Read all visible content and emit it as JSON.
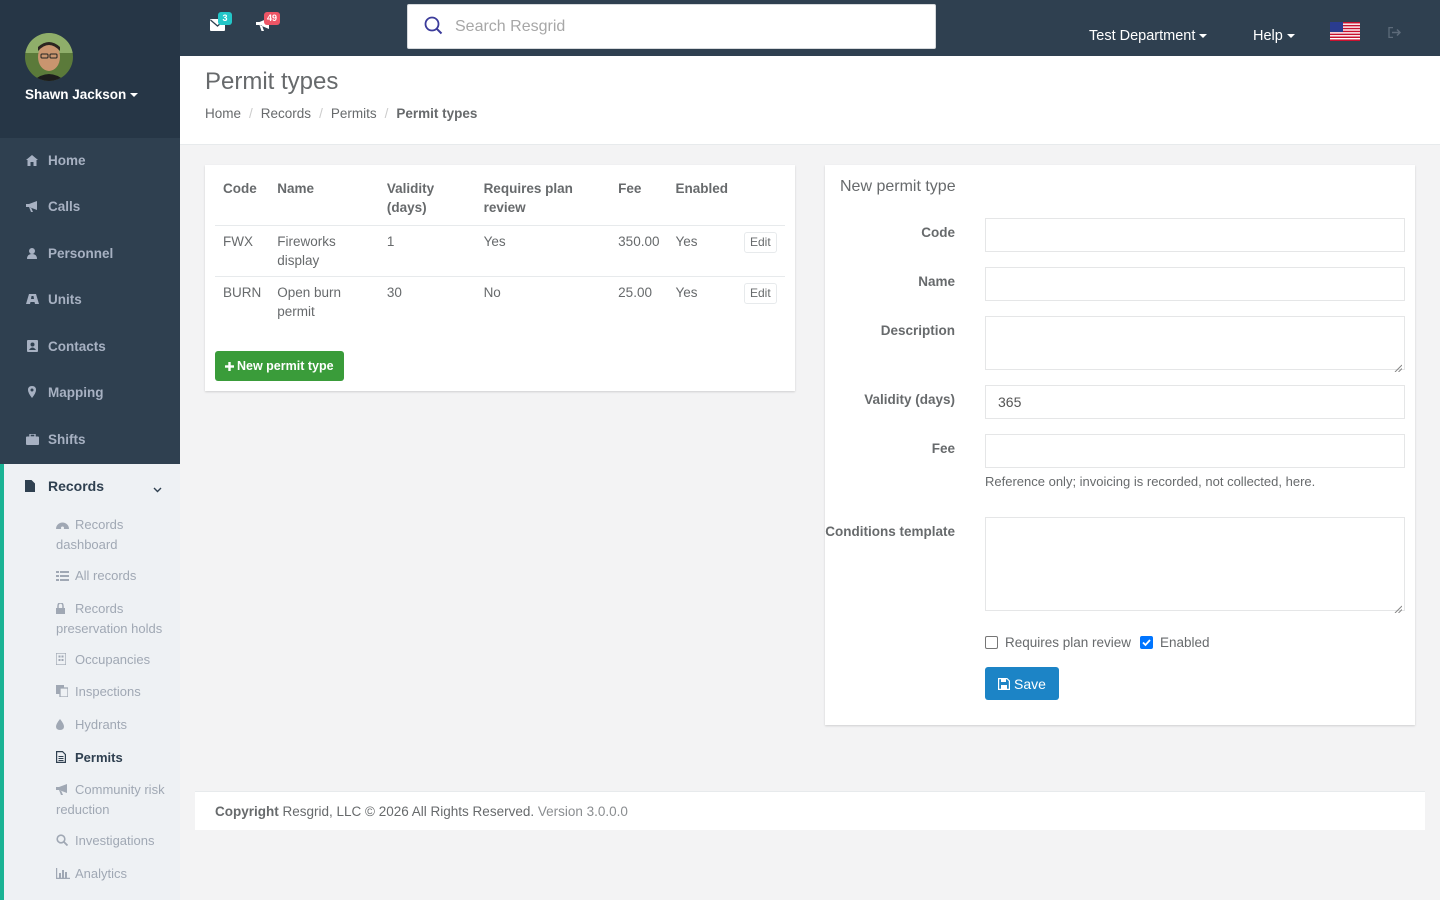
{
  "user": {
    "name": "Shawn Jackson"
  },
  "sidebar": {
    "items": [
      {
        "label": "Home",
        "icon": "home-icon"
      },
      {
        "label": "Calls",
        "icon": "bullhorn-icon"
      },
      {
        "label": "Personnel",
        "icon": "user-icon"
      },
      {
        "label": "Units",
        "icon": "truck-icon"
      },
      {
        "label": "Contacts",
        "icon": "address-book-icon"
      },
      {
        "label": "Mapping",
        "icon": "map-marker-icon"
      },
      {
        "label": "Shifts",
        "icon": "briefcase-icon"
      }
    ],
    "records": {
      "label": "Records",
      "sub_items": [
        {
          "label": "Records dashboard",
          "icon": "dashboard-icon"
        },
        {
          "label": "All records",
          "icon": "list-icon"
        },
        {
          "label": "Records preservation holds",
          "icon": "lock-icon"
        },
        {
          "label": "Occupancies",
          "icon": "building-icon"
        },
        {
          "label": "Inspections",
          "icon": "copy-icon"
        },
        {
          "label": "Hydrants",
          "icon": "tint-icon"
        },
        {
          "label": "Permits",
          "icon": "file-text-icon",
          "active": true
        },
        {
          "label": "Community risk reduction",
          "icon": "bullhorn-icon"
        },
        {
          "label": "Investigations",
          "icon": "search-icon"
        },
        {
          "label": "Analytics",
          "icon": "bar-chart-icon"
        }
      ]
    }
  },
  "topbar": {
    "messages_count": "3",
    "calls_count": "49",
    "search_placeholder": "Search Resgrid",
    "department": "Test Department",
    "help": "Help",
    "colors": {
      "bar": "#2f4050",
      "messages_badge": "#23c6c8",
      "calls_badge": "#ed5565"
    }
  },
  "page": {
    "title": "Permit types",
    "breadcrumbs": [
      "Home",
      "Records",
      "Permits",
      "Permit types"
    ]
  },
  "table": {
    "headers": [
      "Code",
      "Name",
      "Validity (days)",
      "Requires plan review",
      "Fee",
      "Enabled"
    ],
    "rows": [
      {
        "code": "FWX",
        "name": "Fireworks display",
        "validity": "1",
        "plan_review": "Yes",
        "fee": "350.00",
        "enabled": "Yes"
      },
      {
        "code": "BURN",
        "name": "Open burn permit",
        "validity": "30",
        "plan_review": "No",
        "fee": "25.00",
        "enabled": "Yes"
      }
    ],
    "edit_label": "Edit",
    "new_button": "New permit type"
  },
  "form": {
    "title": "New permit type",
    "code_label": "Code",
    "name_label": "Name",
    "description_label": "Description",
    "validity_label": "Validity (days)",
    "validity_value": "365",
    "fee_label": "Fee",
    "fee_help": "Reference only; invoicing is recorded, not collected, here.",
    "conditions_label": "Conditions template",
    "plan_review_label": "Requires plan review",
    "plan_review_checked": false,
    "enabled_label": "Enabled",
    "enabled_checked": true,
    "save_label": "Save"
  },
  "footer": {
    "copyright_bold": "Copyright",
    "copyright": "Resgrid, LLC © 2026 All Rights Reserved.",
    "version": "Version 3.0.0.0"
  }
}
